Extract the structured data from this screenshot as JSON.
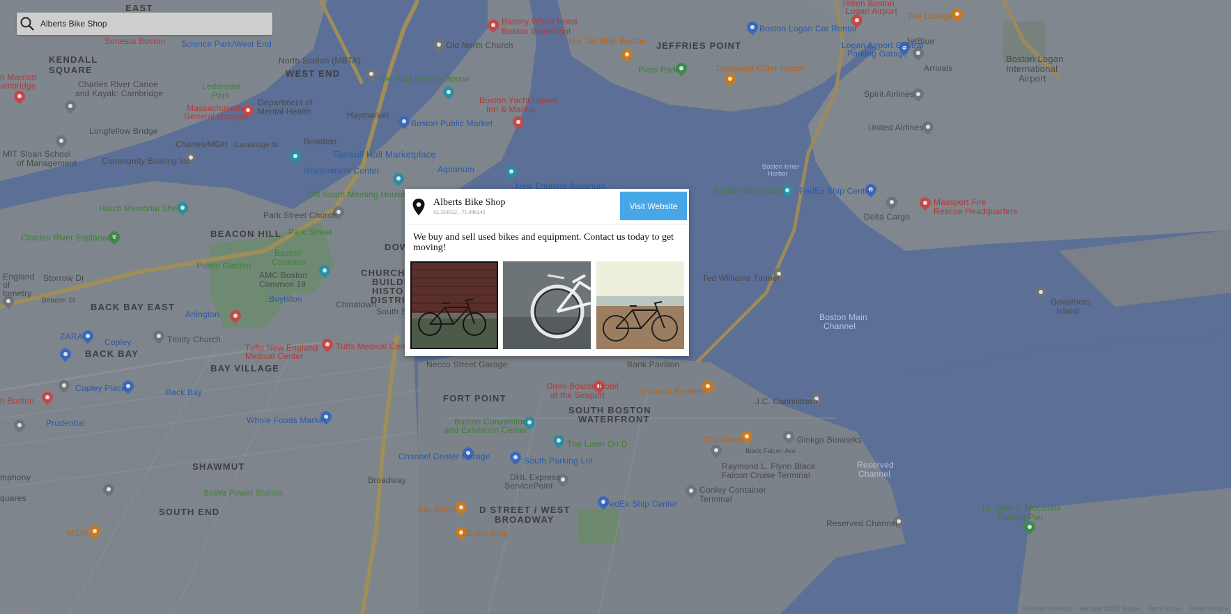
{
  "search": {
    "value": "Alberts Bike Shop"
  },
  "map": {
    "labels": {
      "east_cambridge": "EAST",
      "kendall": "KENDALL",
      "square": "SQUARE",
      "sonesta": "Sonesta Boston",
      "science_park": "Science Park/West End",
      "north_station": "North Station (MBTA)",
      "old_north_church": "Old North Church",
      "battery_wharf": "Battery Wharf Hotel",
      "battery_wharf_2": "Boston Waterfront",
      "tall_ship": "The Tall Ship Boston",
      "jeffries_point": "JEFFRIES POINT",
      "logan_car_rental": "Boston Logan Car Rental",
      "hilton": "Hilton Boston",
      "hilton_2": "Logan Airport",
      "the_lounge": "The Lounge",
      "jetblue": "JetBlue",
      "logan_parking": "Logan Airport Central",
      "logan_parking_2": "Parking Garage",
      "arrivals": "Arrivals",
      "logan_airport": "Boston Logan",
      "logan_airport_2": "International",
      "logan_airport_3": "Airport",
      "piers_park": "Piers Park",
      "downeast": "Downeast Cider House",
      "west_end": "WEST END",
      "paul_revere": "The Paul Revere House",
      "yacht_haven": "Boston Yacht Haven",
      "yacht_haven_2": "Inn & Marina",
      "spirit": "Spirit Airlines",
      "united": "United Airlines",
      "marriott": "n Marriott",
      "marriott_2": "ambridge",
      "charles_canoe": "Charles River Canoe",
      "charles_canoe_2": "and Kayak: Cambridge",
      "lederman": "Lederman",
      "lederman_2": "Park",
      "dmh": "Department of",
      "dmh_2": "Mental Health",
      "mgh": "Massachusetts",
      "mgh_2": "General Hospital",
      "haymarket": "Haymarket",
      "public_market": "Boston Public Market",
      "longfellow": "Longfellow Bridge",
      "charles_mgh": "Charles/MGH",
      "cambridge_st": "Cambridge St",
      "bowdoin": "Bowdoin",
      "faneuil": "Faneuil Hall Marketplace",
      "mit_sloan": "MIT Sloan School",
      "mit_sloan_2": "of Management",
      "community_boating": "Community Boating Inc",
      "gov_center": "Government Center",
      "aquarium": "Aquarium",
      "ne_aquarium": "New England Aquarium",
      "old_south": "Old South Meeting House",
      "inner_harbor": "Boston Inner",
      "inner_harbor_2": "Harbor",
      "skyline": "Skyline Monument",
      "fedex_center": "FedEx Ship Center",
      "massport": "Massport Fire",
      "massport_2": "Rescue Headquarters",
      "delta": "Delta Cargo",
      "hatch_shell": "Hatch Memorial Shell",
      "park_street_church": "Park Street Church",
      "beacon_hill": "BEACON HILL",
      "park_street": "Park Street",
      "charles_esplanade": "Charles River Esplanade",
      "public_garden": "Public Garden",
      "boston_common": "Boston",
      "boston_common_2": "Common",
      "amc": "AMC Boston",
      "amc_2": "Common 19",
      "down": "DOW",
      "church": "CHURCH G",
      "building": "BUILDIN",
      "historic": "HISTO",
      "district": "DISTRIC",
      "te_williams": "Ted Williams Tunnel",
      "governors": "Governors",
      "governors_2": "Island",
      "main_channel": "Boston Main",
      "main_channel_2": "Channel",
      "england": "England",
      "england_2": "of",
      "england_3": "tometry",
      "storrow": "Storrow Dr",
      "beacon_st": "Beacon St",
      "back_bay_east": "BACK BAY EAST",
      "arlington": "Arlington",
      "boylston": "Boylston",
      "chinatown": "Chinatown",
      "south_st": "South St",
      "zara": "ZARA",
      "copley": "Copley",
      "trinity": "Trinity Church",
      "tufts_ne": "Tufts New England",
      "tufts_ne_2": "Medical Center",
      "tufts_center": "Tufts Medical Cente",
      "back_bay": "BACK BAY",
      "bay_village": "BAY VILLAGE",
      "copley_place": "Copley Place",
      "back_bay_station": "Back Bay",
      "necco": "Necco Street Garage",
      "seaport_pavilion": "Bank Pavilion",
      "omni": "Omni Boston Hotel",
      "omni_2": "at the Seaport",
      "harpoon": "Harpoon Brewery",
      "fort_point": "FORT POINT",
      "south_boston": "SOUTH BOSTON",
      "waterfront": "WATERFRONT",
      "jc_cannistraro": "J.C. Cannistraro",
      "n_boston": "n Boston",
      "prudential": "Prudential",
      "whole_foods": "Whole Foods Market",
      "bcec": "Boston Convention",
      "bcec_2": "and Exhibition Center",
      "lawn_on_d": "The Lawn On D",
      "chickadee": "Chickadee",
      "ginkgo": "Ginkgo Bioworks",
      "shawmut": "SHAWMUT",
      "channel_garage": "Channel Center Garage",
      "south_parking": "South Parking Lot",
      "raymond": "Raymond L. Flynn Black",
      "raymond_2": "Falcon Cruise Terminal",
      "reserved": "Reserved",
      "reserved_2": "Channel",
      "mphony": "mphony",
      "broadway": "Broadway",
      "dhl": "DHL Express",
      "dhl_2": "ServicePoint",
      "conley": "Conley Container",
      "conley_2": "Terminal",
      "squares": "quares",
      "sowa": "SoWa Power Station",
      "south_end": "SOUTH END",
      "bar_volpe": "Bar Volpe",
      "d_street": "D STREET / WEST",
      "broadway_hood": "BROADWAY",
      "fedex_2": "FedEx Ship Center",
      "reserved_channel": "Reserved Channel",
      "mcCorkle": "Lt. John J. McCorkle",
      "mcCorkle_2": "Fishing Pier",
      "mida": "MIDA",
      "burger_king": "Burger King",
      "black_falcon": "Black Falcon Ave"
    }
  },
  "popup": {
    "name": "Alberts Bike Shop",
    "coords": "42.354022, -71.046245",
    "visit_label": "Visit Website",
    "description": "We buy and sell used bikes and equipment. Contact us today to get moving!"
  },
  "footer": {
    "google": "Google",
    "shortcuts": "Keyboard shortcuts",
    "mapdata": "Map data ©2022 Google",
    "terms": "Terms of Use",
    "report": "Report a map e"
  }
}
